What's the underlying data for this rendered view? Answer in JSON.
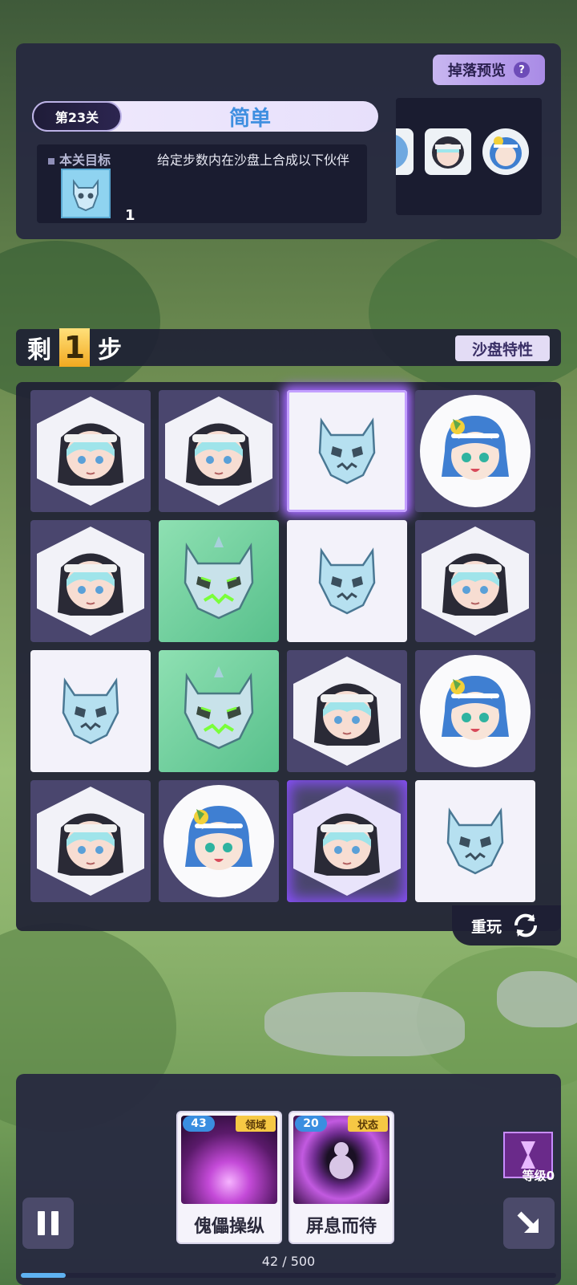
{
  "header": {
    "drop_preview_label": "掉落预览",
    "help_icon": "?",
    "level_label": "第23关",
    "difficulty": "简单"
  },
  "goal": {
    "label": "本关目标",
    "description": "给定步数内在沙盘上合成以下伙伴",
    "target_count": "1"
  },
  "drop_preview": {
    "items": [
      "partial-character",
      "nun-girl",
      "lemon-girl"
    ]
  },
  "steps": {
    "prefix": "剩",
    "value": "1",
    "suffix": "步"
  },
  "sandbox_traits_label": "沙盘特性",
  "board": {
    "rows": [
      [
        "nun-girl",
        "nun-girl",
        "ice-demon-mask",
        "lemon-girl"
      ],
      [
        "nun-girl",
        "green-demon-mask",
        "ice-demon-mask",
        "nun-girl"
      ],
      [
        "ice-demon-mask",
        "green-demon-mask",
        "nun-girl",
        "lemon-girl"
      ],
      [
        "nun-girl",
        "lemon-girl",
        "nun-girl",
        "ice-demon-mask"
      ]
    ]
  },
  "replay_label": "重玩",
  "cards": [
    {
      "cost": "43",
      "type": "领域",
      "name": "傀儡操纵"
    },
    {
      "cost": "20",
      "type": "状态",
      "name": "屏息而待"
    }
  ],
  "level_badge": "等级0",
  "progress": {
    "text": "42 / 500",
    "current": 42,
    "max": 500
  },
  "colors": {
    "accent_purple": "#a56bff",
    "step_gold": "#f2a920",
    "difficulty_blue": "#3f8fe0",
    "progress_blue": "#5fb2f2"
  }
}
